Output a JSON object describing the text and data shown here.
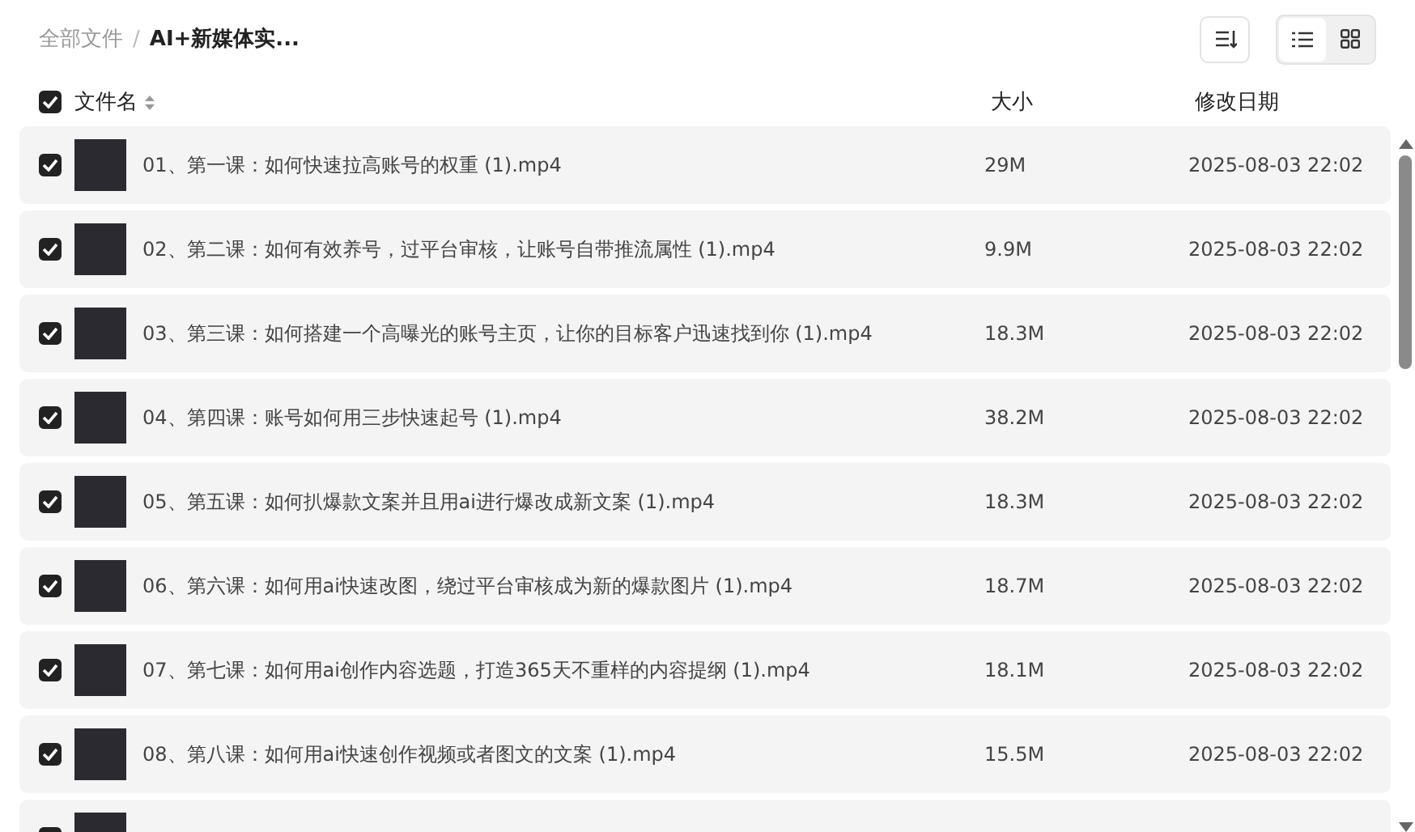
{
  "breadcrumb_separator": "/",
  "breadcrumb": [
    {
      "label": "全部文件",
      "current": false
    },
    {
      "label": "AI+新媒体实...",
      "current": true
    }
  ],
  "view_modes": [
    {
      "kind": "list",
      "selected": true
    },
    {
      "kind": "grid",
      "selected": false
    }
  ],
  "table": {
    "select_all": {
      "checked": true
    },
    "columns": [
      {
        "label": "文件名",
        "sortable": true
      },
      {
        "label": "大小",
        "sortable": false
      },
      {
        "label": "修改日期",
        "sortable": false
      }
    ],
    "rows": [
      {
        "name": "01、第一课：如何快速拉高账号的权重 (1).mp4",
        "size": "29M",
        "modified": "2025-08-03 22:02",
        "checked": true
      },
      {
        "name": "02、第二课：如何有效养号，过平台审核，让账号自带推流属性 (1).mp4",
        "size": "9.9M",
        "modified": "2025-08-03 22:02",
        "checked": true
      },
      {
        "name": "03、第三课：如何搭建一个高曝光的账号主页，让你的目标客户迅速找到你 (1).mp4",
        "size": "18.3M",
        "modified": "2025-08-03 22:02",
        "checked": true
      },
      {
        "name": "04、第四课：账号如何用三步快速起号 (1).mp4",
        "size": "38.2M",
        "modified": "2025-08-03 22:02",
        "checked": true
      },
      {
        "name": "05、第五课：如何扒爆款文案并且用ai进行爆改成新文案 (1).mp4",
        "size": "18.3M",
        "modified": "2025-08-03 22:02",
        "checked": true
      },
      {
        "name": "06、第六课：如何用ai快速改图，绕过平台审核成为新的爆款图片 (1).mp4",
        "size": "18.7M",
        "modified": "2025-08-03 22:02",
        "checked": true
      },
      {
        "name": "07、第七课：如何用ai创作内容选题，打造365天不重样的内容提纲 (1).mp4",
        "size": "18.1M",
        "modified": "2025-08-03 22:02",
        "checked": true
      },
      {
        "name": "08、第八课：如何用ai快速创作视频或者图文的文案 (1).mp4",
        "size": "15.5M",
        "modified": "2025-08-03 22:02",
        "checked": true
      },
      {
        "checked": true
      }
    ]
  }
}
